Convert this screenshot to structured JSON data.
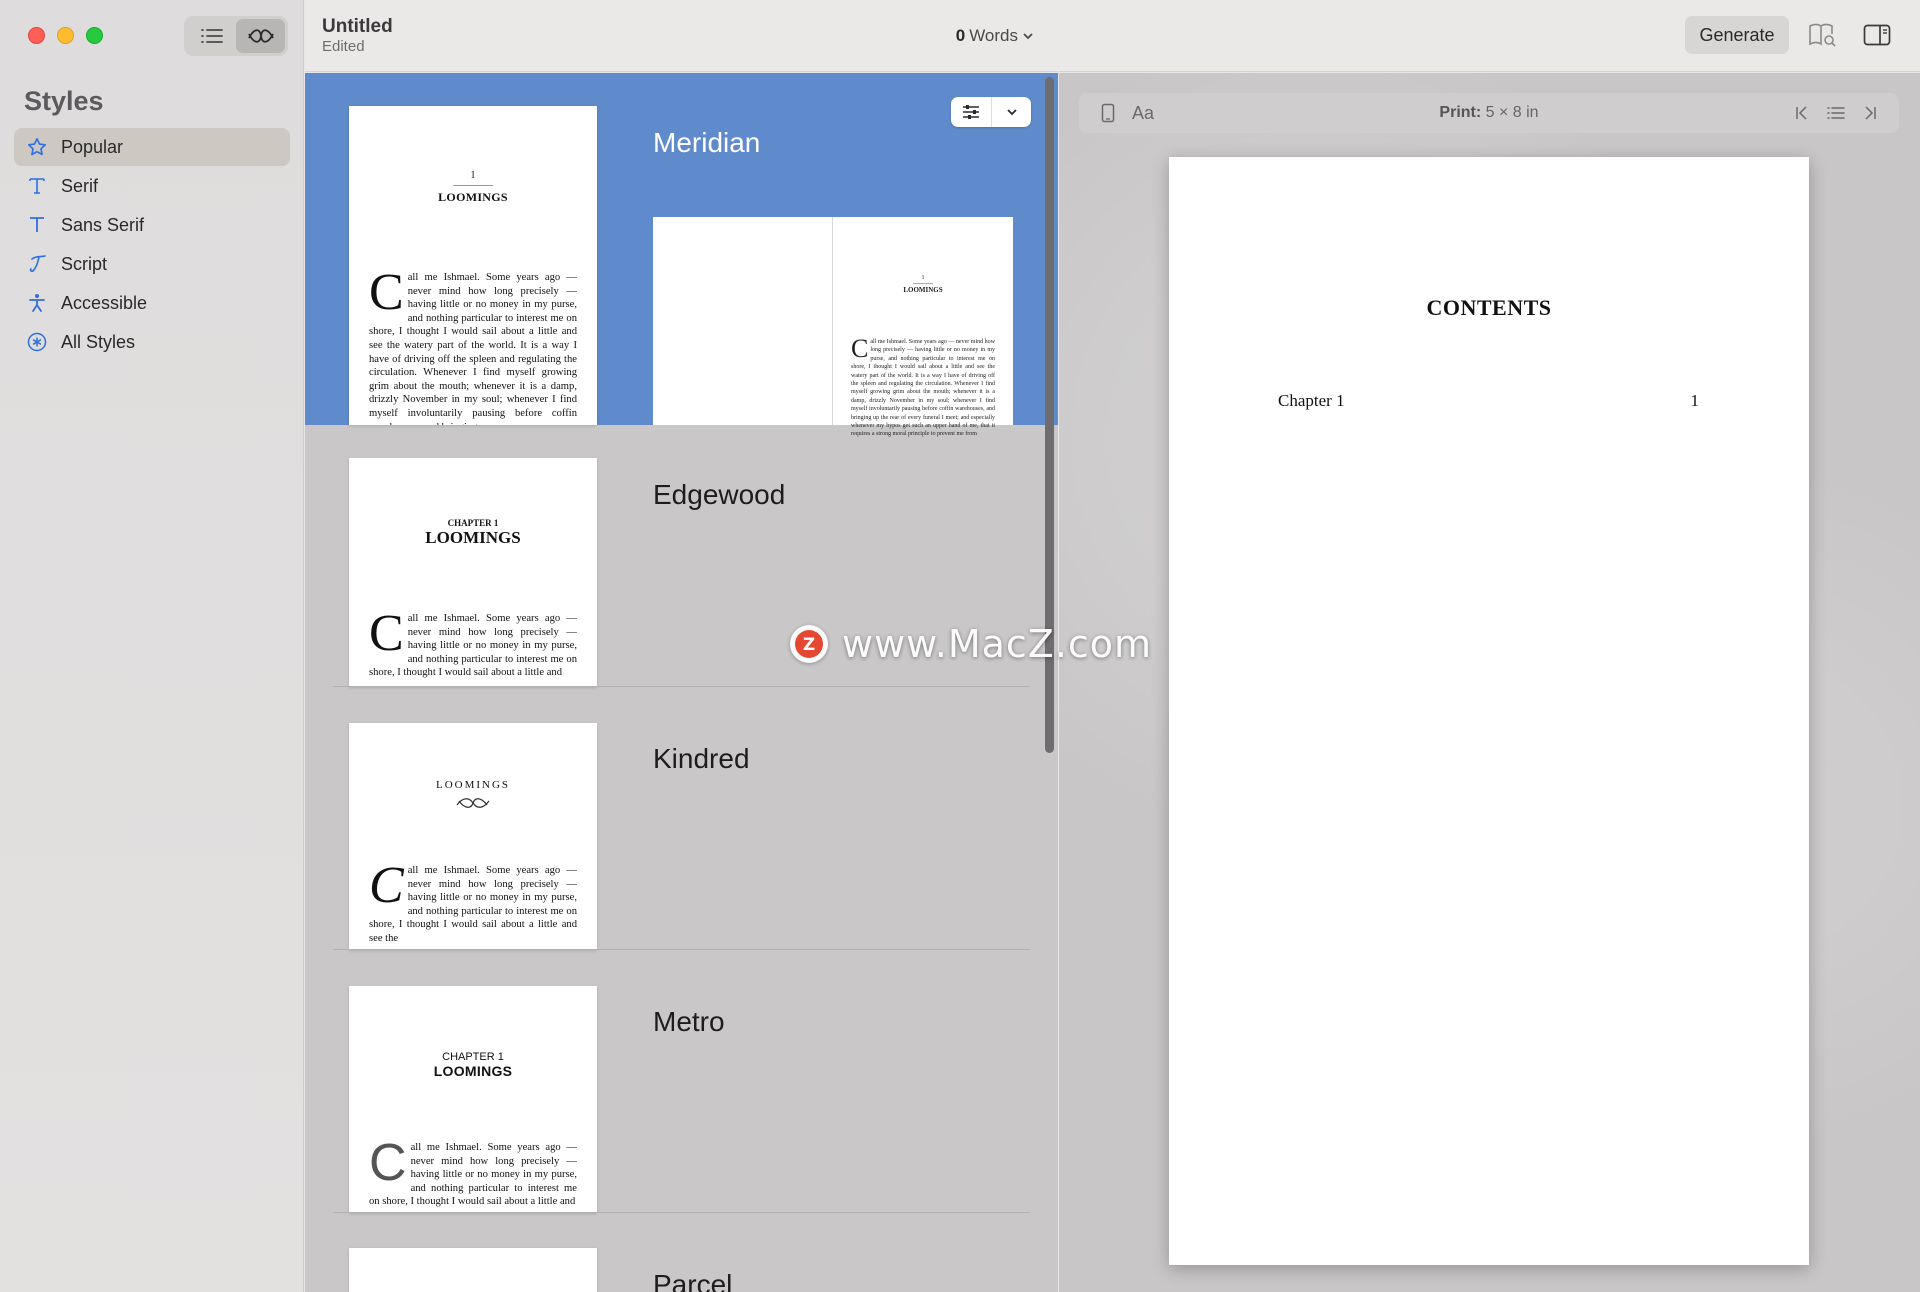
{
  "sidebar": {
    "title": "Styles",
    "items": [
      {
        "label": "Popular",
        "icon": "star-icon"
      },
      {
        "label": "Serif",
        "icon": "serif-t-icon"
      },
      {
        "label": "Sans Serif",
        "icon": "sans-t-icon"
      },
      {
        "label": "Script",
        "icon": "script-t-icon"
      },
      {
        "label": "Accessible",
        "icon": "accessibility-icon"
      },
      {
        "label": "All Styles",
        "icon": "asterisk-circle-icon"
      }
    ]
  },
  "doc": {
    "title": "Untitled",
    "status": "Edited",
    "word_count": "0",
    "word_label": "Words"
  },
  "toolbar": {
    "generate_label": "Generate"
  },
  "styles": [
    {
      "name": "Meridian",
      "num": "1",
      "heading": "LOOMINGS",
      "drop": "C",
      "body": "all me Ishmael. Some years ago — never mind how long precisely — having little or no money in my purse, and nothing particular to interest me on shore, I thought I would sail about a little and see the watery part of the world. It is a way I have of driving off the spleen and regulating the circulation. Whenever I find myself growing grim about the mouth; whenever it is a damp, drizzly November in my soul; whenever I find myself involuntarily pausing before coffin warehouses, and bringing up",
      "spread_num": "1",
      "spread_heading": "LOOMINGS",
      "spread_body": "all me Ishmael. Some years ago — never mind how long precisely — having little or no money in my purse, and nothing particular to interest me on shore, I thought I would sail about a little and see the watery part of the world. It is a way I have of driving off the spleen and regulating the circulation. Whenever I find myself growing grim about the mouth; whenever it is a damp, drizzly November in my soul; whenever I find myself involuntarily pausing before coffin warehouses, and bringing up the rear of every funeral I meet; and especially whenever my hypos get such an upper hand of me, that it requires a strong moral principle to prevent me from"
    },
    {
      "name": "Edgewood",
      "chapter": "CHAPTER 1",
      "heading": "LOOMINGS",
      "drop": "C",
      "body": "all me Ishmael. Some years ago — never mind how long precisely — having little or no money in my purse, and nothing particular to interest me on shore, I thought I would sail about a little and"
    },
    {
      "name": "Kindred",
      "heading": "LOOMINGS",
      "drop": "C",
      "body": "all me Ishmael. Some years ago — never mind how long precisely — having little or no money in my purse, and nothing particular to interest me on shore, I thought I would sail about a little and see the"
    },
    {
      "name": "Metro",
      "chapter": "CHAPTER 1",
      "heading": "LOOMINGS",
      "drop": "C",
      "body": "all me Ishmael. Some years ago — never mind how long precisely — having little or no money in my purse, and nothing particular to interest me on shore, I thought I would sail about a little and"
    },
    {
      "name": "Parcel"
    }
  ],
  "preview": {
    "aa_label": "Aa",
    "print_key": "Print:",
    "print_value": " 5 × 8 in",
    "page_heading": "CONTENTS",
    "toc": [
      {
        "title": "Chapter 1",
        "page": "1"
      }
    ]
  },
  "watermark": {
    "text": "www.MacZ.com",
    "logo_letter": "Z"
  },
  "colors": {
    "accent": "#2f6fe0",
    "selection": "#5f8bcc"
  }
}
